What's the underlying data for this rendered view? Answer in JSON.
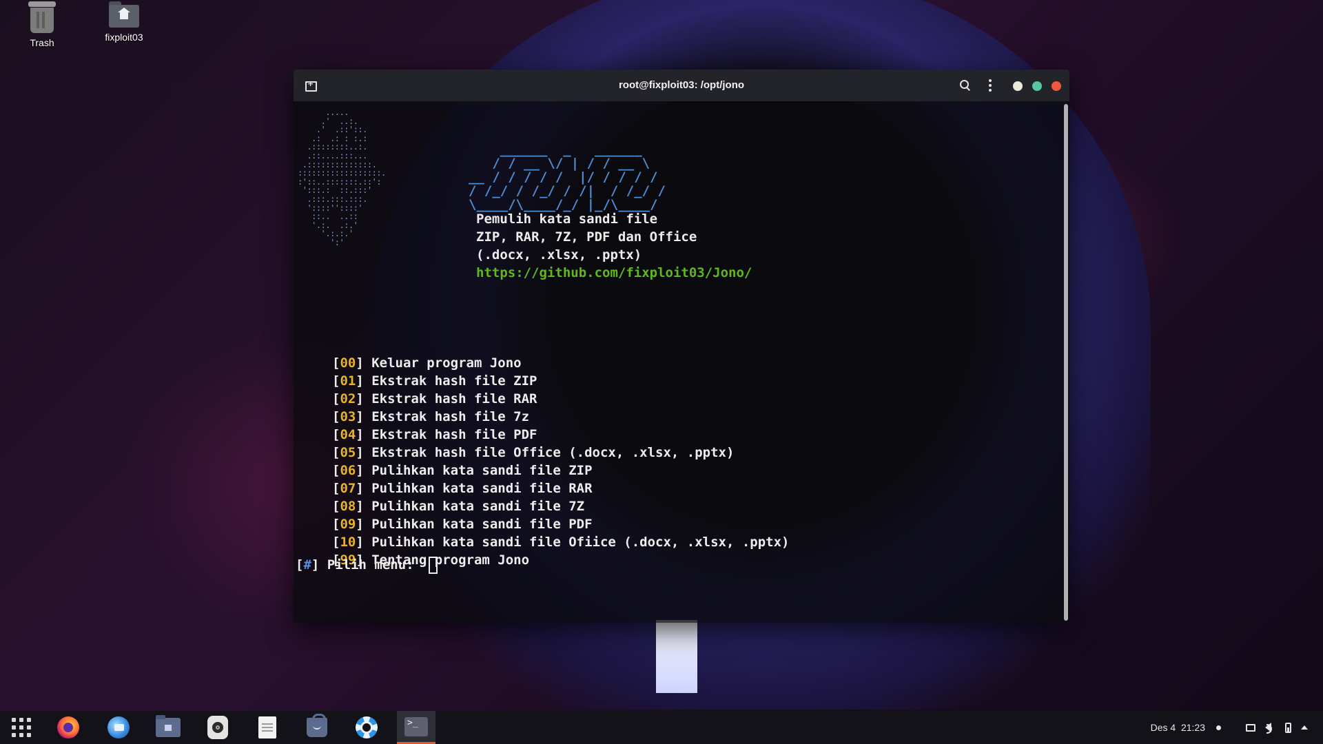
{
  "desktop": {
    "icons": [
      {
        "label": "Trash",
        "icon": "trash-icon"
      },
      {
        "label": "fixploit03",
        "icon": "home-folder-icon"
      }
    ]
  },
  "terminal": {
    "title": "root@fixploit03: /opt/jono",
    "ascii_ghost": "      .....\n     .'  ..:.\n    .'  .::'::.\n   .:  .: : :.:\n  .::::::::..:.\n  .::....:::...\n .::::::::::::::.\n::::::::::::::::::.\n:'::..:::::::.::':\n ':::.:  ::.:::'\n  .:::.:::.:::.\n  '::::''::::'\n   ::..  ..::\n   '.:.  .:.'\n     '.:.:.'\n       ':'",
    "ascii_logo": "    ______  _   ______\n   / / __ \\/ | / / __ \\\n__ / / / / /  |/ / / / /\n/ /_/ / /_/ / /|  / /_/ /\n\\____/\\____/_/ |_/\\____/",
    "info": [
      "Pemulih kata sandi file",
      "ZIP, RAR, 7Z, PDF dan Office",
      "(.docx, .xlsx, .pptx)"
    ],
    "url": "https://github.com/fixploit03/Jono/",
    "menu": [
      {
        "code": "00",
        "label": "Keluar program Jono"
      },
      {
        "code": "01",
        "label": "Ekstrak hash file ZIP"
      },
      {
        "code": "02",
        "label": "Ekstrak hash file RAR"
      },
      {
        "code": "03",
        "label": "Ekstrak hash file 7z"
      },
      {
        "code": "04",
        "label": "Ekstrak hash file PDF"
      },
      {
        "code": "05",
        "label": "Ekstrak hash file Office (.docx, .xlsx, .pptx)"
      },
      {
        "code": "06",
        "label": "Pulihkan kata sandi file ZIP"
      },
      {
        "code": "07",
        "label": "Pulihkan kata sandi file RAR"
      },
      {
        "code": "08",
        "label": "Pulihkan kata sandi file 7Z"
      },
      {
        "code": "09",
        "label": "Pulihkan kata sandi file PDF"
      },
      {
        "code": "10",
        "label": "Pulihkan kata sandi file Ofiice (.docx, .xlsx, .pptx)"
      },
      {
        "code": "99",
        "label": "Tentang program Jono"
      }
    ],
    "prompt": {
      "symbol": "#",
      "label": " Pilih menu: "
    },
    "colors": {
      "menu_code": "#e7b32e",
      "url": "#5fb81f",
      "logo": "#4f8ed8",
      "prompt_symbol": "#5b8fe0"
    }
  },
  "taskbar": {
    "apps": [
      "app-grid-icon",
      "firefox-icon",
      "thunderbird-icon",
      "files-icon",
      "music-player-icon",
      "text-editor-icon",
      "software-store-icon",
      "help-icon",
      "terminal-icon"
    ],
    "terminal_glyph": ">_",
    "date": "Des 4",
    "time": "21:23"
  }
}
